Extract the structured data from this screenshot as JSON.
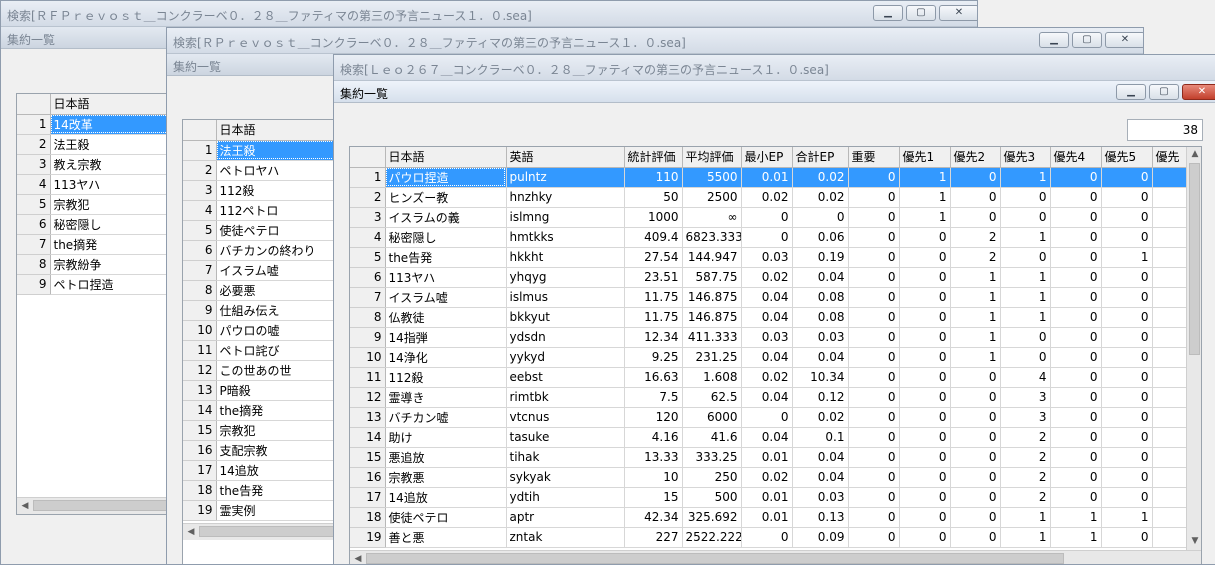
{
  "windows": [
    {
      "title": "検索[ＲＦＰｒｅｖｏｓｔ＿コンクラーベ０．２８＿ファティマの第三の予言ニュース１．０.sea]",
      "subtitle": "集約一覧",
      "column_header": "日本語",
      "rows": [
        {
          "n": "1",
          "text": "14改革"
        },
        {
          "n": "2",
          "text": "法王殺"
        },
        {
          "n": "3",
          "text": "教え宗教"
        },
        {
          "n": "4",
          "text": "113ヤハ"
        },
        {
          "n": "5",
          "text": "宗教犯"
        },
        {
          "n": "6",
          "text": "秘密隠し"
        },
        {
          "n": "7",
          "text": "the摘発"
        },
        {
          "n": "8",
          "text": "宗教紛争"
        },
        {
          "n": "9",
          "text": "ペトロ捏造"
        }
      ]
    },
    {
      "title": "検索[ＲＰｒｅｖｏｓｔ＿コンクラーベ０．２８＿ファティマの第三の予言ニュース１．０.sea]",
      "subtitle": "集約一覧",
      "column_header": "日本語",
      "rows": [
        {
          "n": "1",
          "text": "法王殺"
        },
        {
          "n": "2",
          "text": "ペトロヤハ"
        },
        {
          "n": "3",
          "text": "112殺"
        },
        {
          "n": "4",
          "text": "112ペトロ"
        },
        {
          "n": "5",
          "text": "使徒ペテロ"
        },
        {
          "n": "6",
          "text": "バチカンの終わり"
        },
        {
          "n": "7",
          "text": "イスラム嘘"
        },
        {
          "n": "8",
          "text": "必要悪"
        },
        {
          "n": "9",
          "text": "仕組み伝え"
        },
        {
          "n": "10",
          "text": "パウロの嘘"
        },
        {
          "n": "11",
          "text": "ペトロ詫び"
        },
        {
          "n": "12",
          "text": "この世あの世"
        },
        {
          "n": "13",
          "text": "P暗殺"
        },
        {
          "n": "14",
          "text": "the摘発"
        },
        {
          "n": "15",
          "text": "宗教犯"
        },
        {
          "n": "16",
          "text": "支配宗教"
        },
        {
          "n": "17",
          "text": "14追放"
        },
        {
          "n": "18",
          "text": "the告発"
        },
        {
          "n": "19",
          "text": "霊実例"
        }
      ]
    },
    {
      "title": "検索[Ｌｅｏ２６７＿コンクラーベ０．２８＿ファティマの第三の予言ニュース１．０.sea]",
      "subtitle": "集約一覧",
      "count": "38",
      "headers": [
        "日本語",
        "英語",
        "統計評価",
        "平均評価",
        "最小EP",
        "合計EP",
        "重要",
        "優先1",
        "優先2",
        "優先3",
        "優先4",
        "優先5",
        "優先"
      ],
      "rows": [
        {
          "n": "1",
          "c": [
            "パウロ捏造",
            "pulntz",
            "110",
            "5500",
            "0.01",
            "0.02",
            "0",
            "1",
            "0",
            "1",
            "0",
            "0"
          ]
        },
        {
          "n": "2",
          "c": [
            "ヒンズー教",
            "hnzhky",
            "50",
            "2500",
            "0.02",
            "0.02",
            "0",
            "1",
            "0",
            "0",
            "0",
            "0"
          ]
        },
        {
          "n": "3",
          "c": [
            "イスラムの義",
            "islmng",
            "1000",
            "∞",
            "0",
            "0",
            "0",
            "1",
            "0",
            "0",
            "0",
            "0"
          ]
        },
        {
          "n": "4",
          "c": [
            "秘密隠し",
            "hmtkks",
            "409.4",
            "6823.333",
            "0",
            "0.06",
            "0",
            "0",
            "2",
            "1",
            "0",
            "0"
          ]
        },
        {
          "n": "5",
          "c": [
            "the告発",
            "hkkht",
            "27.54",
            "144.947",
            "0.03",
            "0.19",
            "0",
            "0",
            "2",
            "0",
            "0",
            "1"
          ]
        },
        {
          "n": "6",
          "c": [
            "113ヤハ",
            "yhqyg",
            "23.51",
            "587.75",
            "0.02",
            "0.04",
            "0",
            "0",
            "1",
            "1",
            "0",
            "0"
          ]
        },
        {
          "n": "7",
          "c": [
            "イスラム嘘",
            "islmus",
            "11.75",
            "146.875",
            "0.04",
            "0.08",
            "0",
            "0",
            "1",
            "1",
            "0",
            "0"
          ]
        },
        {
          "n": "8",
          "c": [
            "仏教徒",
            "bkkyut",
            "11.75",
            "146.875",
            "0.04",
            "0.08",
            "0",
            "0",
            "1",
            "1",
            "0",
            "0"
          ]
        },
        {
          "n": "9",
          "c": [
            "14指弾",
            "ydsdn",
            "12.34",
            "411.333",
            "0.03",
            "0.03",
            "0",
            "0",
            "1",
            "0",
            "0",
            "0"
          ]
        },
        {
          "n": "10",
          "c": [
            "14浄化",
            "yykyd",
            "9.25",
            "231.25",
            "0.04",
            "0.04",
            "0",
            "0",
            "1",
            "0",
            "0",
            "0"
          ]
        },
        {
          "n": "11",
          "c": [
            "112殺",
            "eebst",
            "16.63",
            "1.608",
            "0.02",
            "10.34",
            "0",
            "0",
            "0",
            "4",
            "0",
            "0"
          ]
        },
        {
          "n": "12",
          "c": [
            "霊導き",
            "rimtbk",
            "7.5",
            "62.5",
            "0.04",
            "0.12",
            "0",
            "0",
            "0",
            "3",
            "0",
            "0"
          ]
        },
        {
          "n": "13",
          "c": [
            "バチカン嘘",
            "vtcnus",
            "120",
            "6000",
            "0",
            "0.02",
            "0",
            "0",
            "0",
            "3",
            "0",
            "0"
          ]
        },
        {
          "n": "14",
          "c": [
            "助け",
            "tasuke",
            "4.16",
            "41.6",
            "0.04",
            "0.1",
            "0",
            "0",
            "0",
            "2",
            "0",
            "0"
          ]
        },
        {
          "n": "15",
          "c": [
            "悪追放",
            "tihak",
            "13.33",
            "333.25",
            "0.01",
            "0.04",
            "0",
            "0",
            "0",
            "2",
            "0",
            "0"
          ]
        },
        {
          "n": "16",
          "c": [
            "宗教悪",
            "sykyak",
            "10",
            "250",
            "0.02",
            "0.04",
            "0",
            "0",
            "0",
            "2",
            "0",
            "0"
          ]
        },
        {
          "n": "17",
          "c": [
            "14追放",
            "ydtih",
            "15",
            "500",
            "0.01",
            "0.03",
            "0",
            "0",
            "0",
            "2",
            "0",
            "0"
          ]
        },
        {
          "n": "18",
          "c": [
            "使徒ペテロ",
            "aptr",
            "42.34",
            "325.692",
            "0.01",
            "0.13",
            "0",
            "0",
            "0",
            "1",
            "1",
            "1"
          ]
        },
        {
          "n": "19",
          "c": [
            "善と悪",
            "zntak",
            "227",
            "2522.222",
            "0",
            "0.09",
            "0",
            "0",
            "0",
            "1",
            "1",
            "0"
          ]
        }
      ]
    }
  ]
}
